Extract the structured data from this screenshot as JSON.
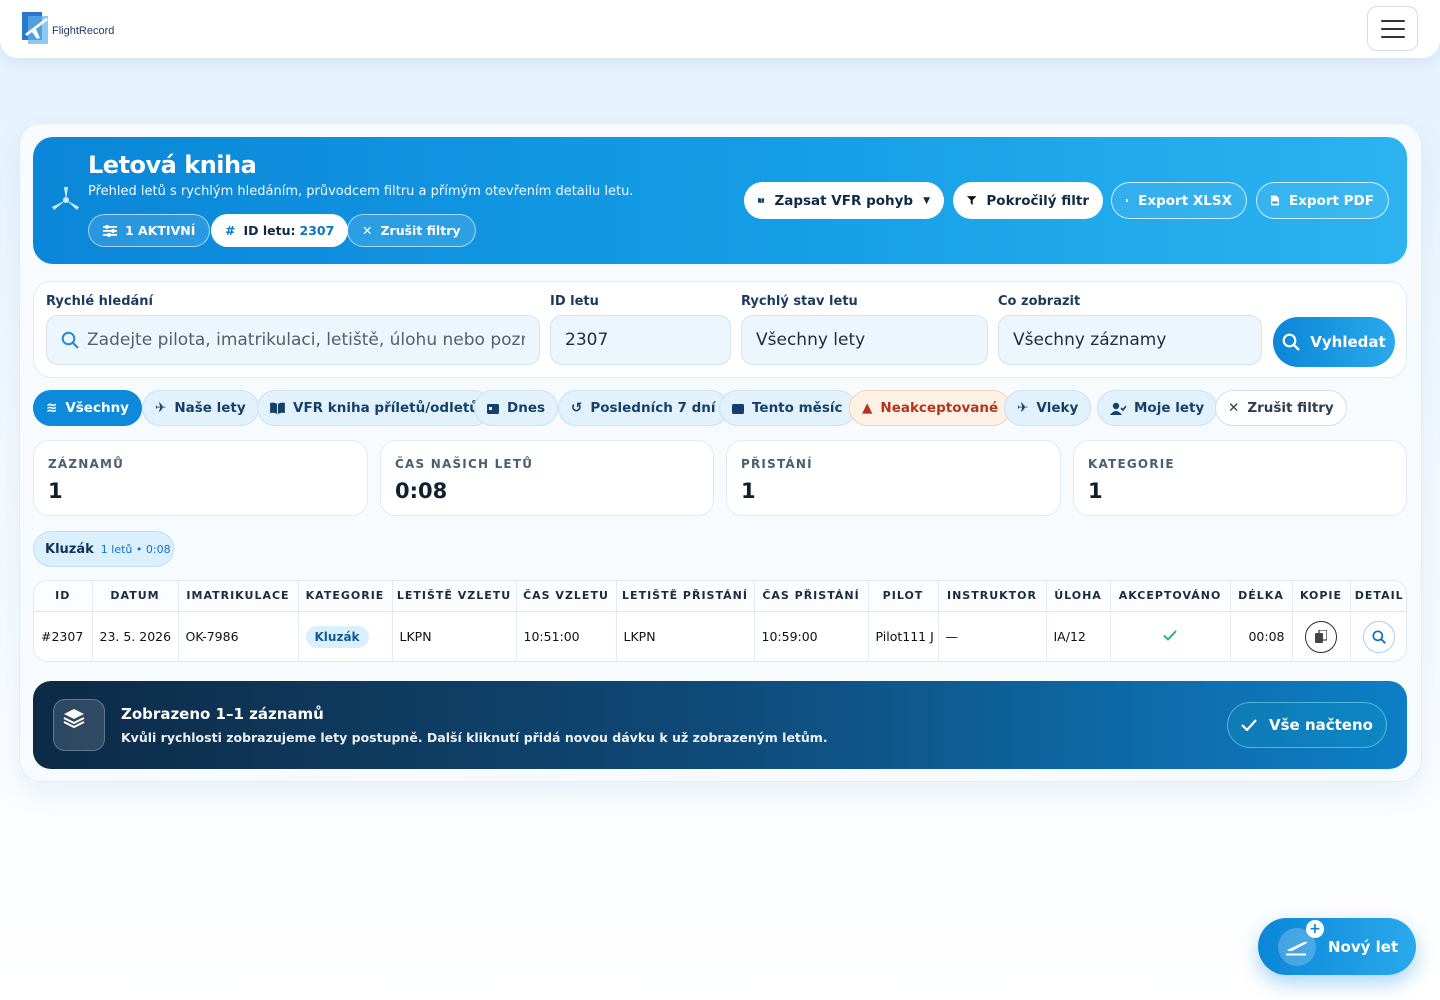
{
  "app": {
    "logo_text": "FlightRecord"
  },
  "hero": {
    "title": "Letová kniha",
    "subtitle": "Přehled letů s rychlým hledáním, průvodcem filtru a přímým otevřením detailu letu.",
    "active_chip": "1 AKTIVNÍ",
    "id_chip_label": "ID letu:",
    "id_chip_value": "2307",
    "clear_chip": "Zrušit filtry",
    "actions": {
      "vfr": "Zapsat VFR pohyb",
      "advanced_filter": "Pokročilý filtr",
      "export_xlsx": "Export XLSX",
      "export_pdf": "Export PDF"
    }
  },
  "search": {
    "quick_label": "Rychlé hledání",
    "quick_placeholder": "Zadejte pilota, imatrikulaci, letiště, úlohu nebo poznámku",
    "id_label": "ID letu",
    "id_value": "2307",
    "status_label": "Rychlý stav letu",
    "status_value": "Všechny lety",
    "show_label": "Co zobrazit",
    "show_value": "Všechny záznamy",
    "button": "Vyhledat"
  },
  "filters": [
    {
      "label": "Všechny",
      "icon": "layers-icon",
      "state": "active"
    },
    {
      "label": "Naše lety",
      "icon": "plane-icon",
      "state": "normal"
    },
    {
      "label": "VFR kniha příletů/odletů",
      "icon": "book-icon",
      "state": "normal"
    },
    {
      "label": "Dnes",
      "icon": "calendar-day-icon",
      "state": "normal"
    },
    {
      "label": "Posledních 7 dní",
      "icon": "history-icon",
      "state": "normal"
    },
    {
      "label": "Tento měsíc",
      "icon": "calendar-icon",
      "state": "normal"
    },
    {
      "label": "Neakceptované",
      "icon": "warning-icon",
      "state": "warn"
    },
    {
      "label": "Vleky",
      "icon": "takeoff-icon",
      "state": "normal"
    },
    {
      "label": "Moje lety",
      "icon": "user-check-icon",
      "state": "normal"
    },
    {
      "label": "Zrušit filtry",
      "icon": "close-icon",
      "state": "plain"
    }
  ],
  "stats": [
    {
      "label": "ZÁZNAMŮ",
      "value": "1"
    },
    {
      "label": "ČAS NAŠICH LETŮ",
      "value": "0:08"
    },
    {
      "label": "PŘISTÁNÍ",
      "value": "1"
    },
    {
      "label": "KATEGORIE",
      "value": "1"
    }
  ],
  "category_summary": {
    "name": "Kluzák",
    "meta": "1 letů • 0:08"
  },
  "table": {
    "headers": [
      "ID",
      "DATUM",
      "IMATRIKULACE",
      "KATEGORIE",
      "LETIŠTĚ VZLETU",
      "ČAS VZLETU",
      "LETIŠTĚ PŘISTÁNÍ",
      "ČAS PŘISTÁNÍ",
      "PILOT",
      "INSTRUKTOR",
      "ÚLOHA",
      "AKCEPTOVÁNO",
      "DÉLKA",
      "KOPIE",
      "DETAIL"
    ],
    "rows": [
      {
        "id": "#2307",
        "date": "23. 5. 2026",
        "registration": "OK-7986",
        "category": "Kluzák",
        "takeoff_airport": "LKPN",
        "takeoff_time": "10:51:00",
        "landing_airport": "LKPN",
        "landing_time": "10:59:00",
        "pilot": "Pilot111 J",
        "instructor": "—",
        "task": "IA/12",
        "accepted": true,
        "duration": "00:08"
      }
    ]
  },
  "banner": {
    "title": "Zobrazeno 1–1 záznamů",
    "subtitle": "Kvůli rychlosti zobrazujeme lety postupně. Další kliknutí přidá novou dávku k už zobrazeným letům.",
    "button": "Vše načteno"
  },
  "fab": {
    "label": "Nový let"
  },
  "colors": {
    "primary": "#0b86d8",
    "warn": "#b2361d",
    "success": "#22b573",
    "dark": "#0d2a45"
  }
}
